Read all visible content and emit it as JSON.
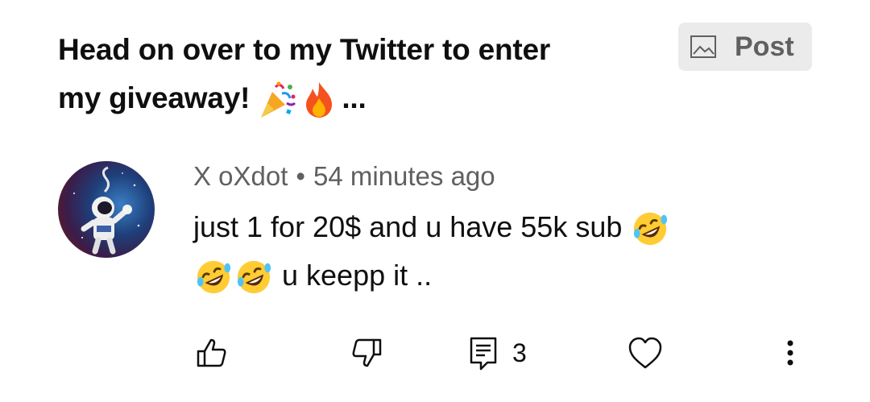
{
  "post": {
    "title_line1": "Head on over to my Twitter to enter",
    "title_line2": "my giveaway!",
    "title_emojis": [
      "party-popper-emoji",
      "fire-emoji"
    ],
    "title_ellipsis": "...",
    "post_chip_label": "Post",
    "post_chip_icon": "image-icon"
  },
  "comment": {
    "author": "X oXdot",
    "separator": "•",
    "time": "54 minutes ago",
    "text_line1": "just 1 for 20$ and u have 55k sub",
    "text_line2": "u keepp it ..",
    "emoji": "rolling-on-floor-laughing-emoji",
    "avatar_icon": "astronaut-avatar"
  },
  "actions": {
    "like_icon": "thumbs-up-icon",
    "dislike_icon": "thumbs-down-icon",
    "reply_icon": "comment-icon",
    "reply_count": "3",
    "heart_icon": "heart-icon",
    "more_icon": "more-vertical-icon"
  },
  "colors": {
    "text_primary": "#0f0f0f",
    "text_secondary": "#606060",
    "chip_background": "#ebebeb"
  }
}
